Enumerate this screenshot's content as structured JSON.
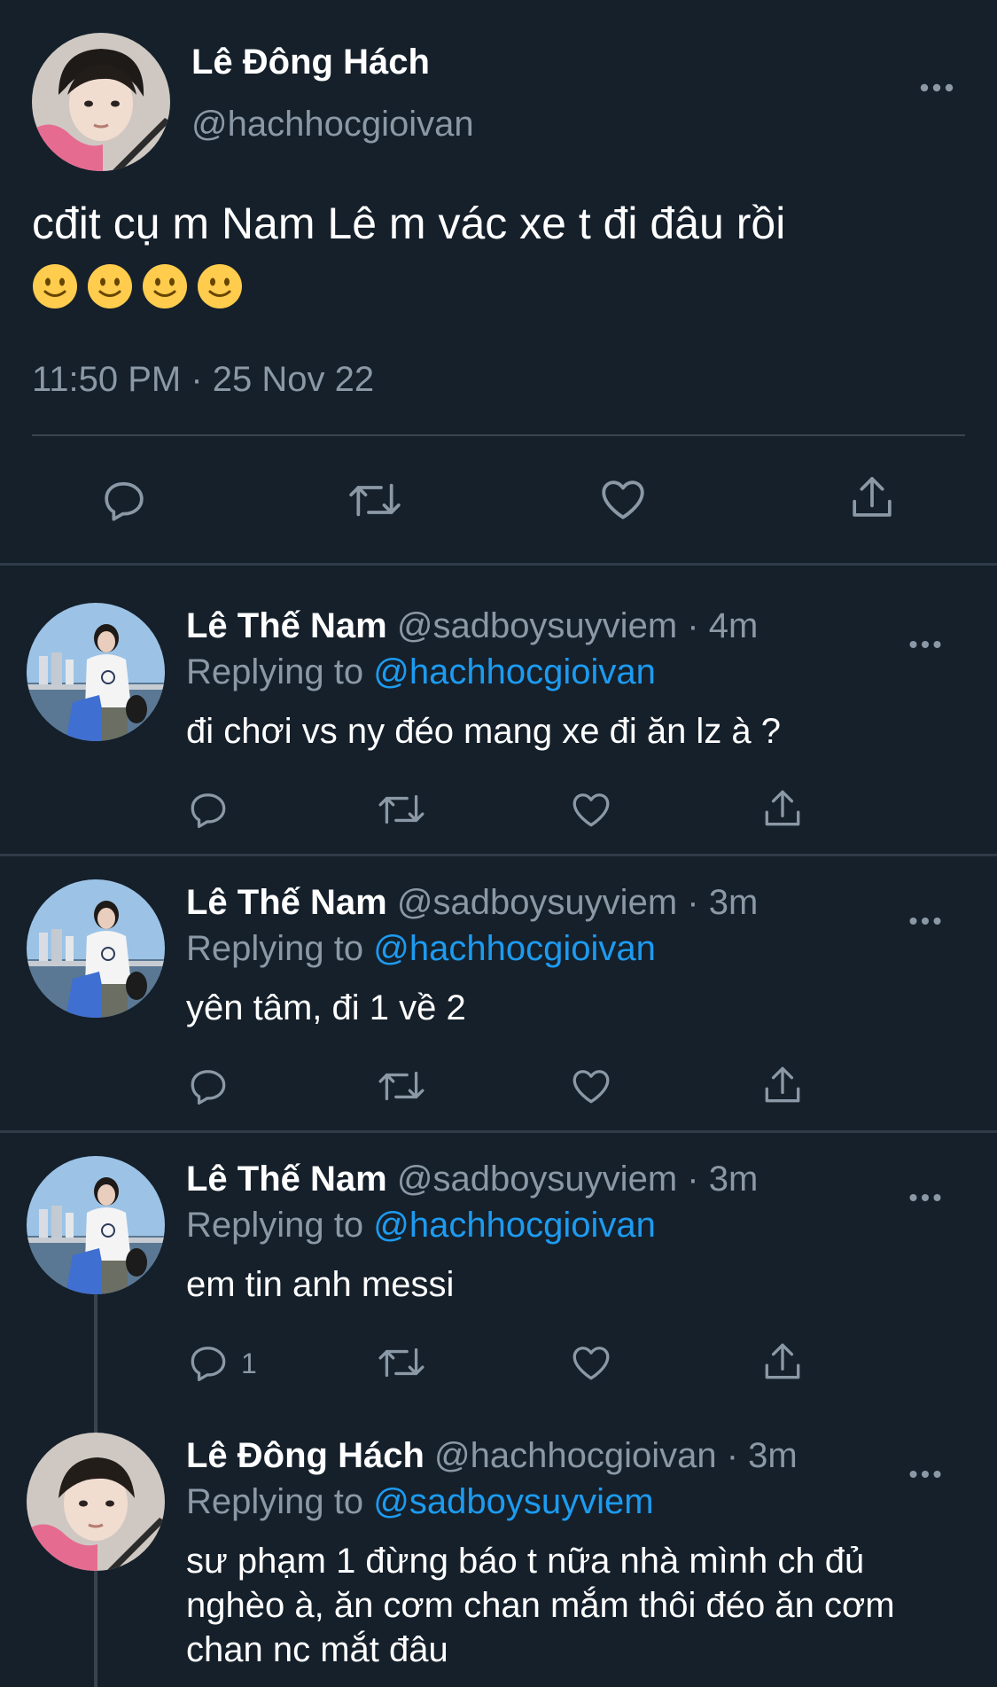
{
  "main_tweet": {
    "name": "Lê Đông Hách",
    "handle": "@hachhocgioivan",
    "text": "cđit cụ m Nam Lê m vác xe t đi đâu rồi",
    "emojis": [
      "slightly-smiling-face",
      "slightly-smiling-face",
      "slightly-smiling-face",
      "slightly-smiling-face"
    ],
    "timestamp": "11:50 PM · 25 Nov 22"
  },
  "replies": [
    {
      "name": "Lê Thế Nam",
      "handle": "@sadboysuyviem",
      "time": "· 4m",
      "replying_prefix": "Replying to ",
      "replying_to": "@hachhocgioivan",
      "text": "đi chơi vs ny đéo mang xe đi ăn lz à ?",
      "reply_count": ""
    },
    {
      "name": "Lê Thế Nam",
      "handle": "@sadboysuyviem",
      "time": "· 3m",
      "replying_prefix": "Replying to ",
      "replying_to": "@hachhocgioivan",
      "text": "yên tâm, đi 1 về 2",
      "reply_count": ""
    },
    {
      "name": "Lê Thế Nam",
      "handle": "@sadboysuyviem",
      "time": "· 3m",
      "replying_prefix": "Replying to ",
      "replying_to": "@hachhocgioivan",
      "text": "em tin anh messi",
      "reply_count": "1"
    },
    {
      "name": "Lê Đông Hách",
      "handle": "@hachhocgioivan",
      "time": "· 3m",
      "replying_prefix": "Replying to ",
      "replying_to": "@sadboysuyviem",
      "text": "sư phạm 1 đừng báo t nữa nhà mình ch đủ nghèo à, ăn cơm chan mắm thôi đéo ăn cơm chan nc mắt đâu",
      "reply_count": ""
    }
  ],
  "theme": {
    "background": "#15202b",
    "muted": "#8b98a5",
    "accent": "#1d9bf0"
  }
}
